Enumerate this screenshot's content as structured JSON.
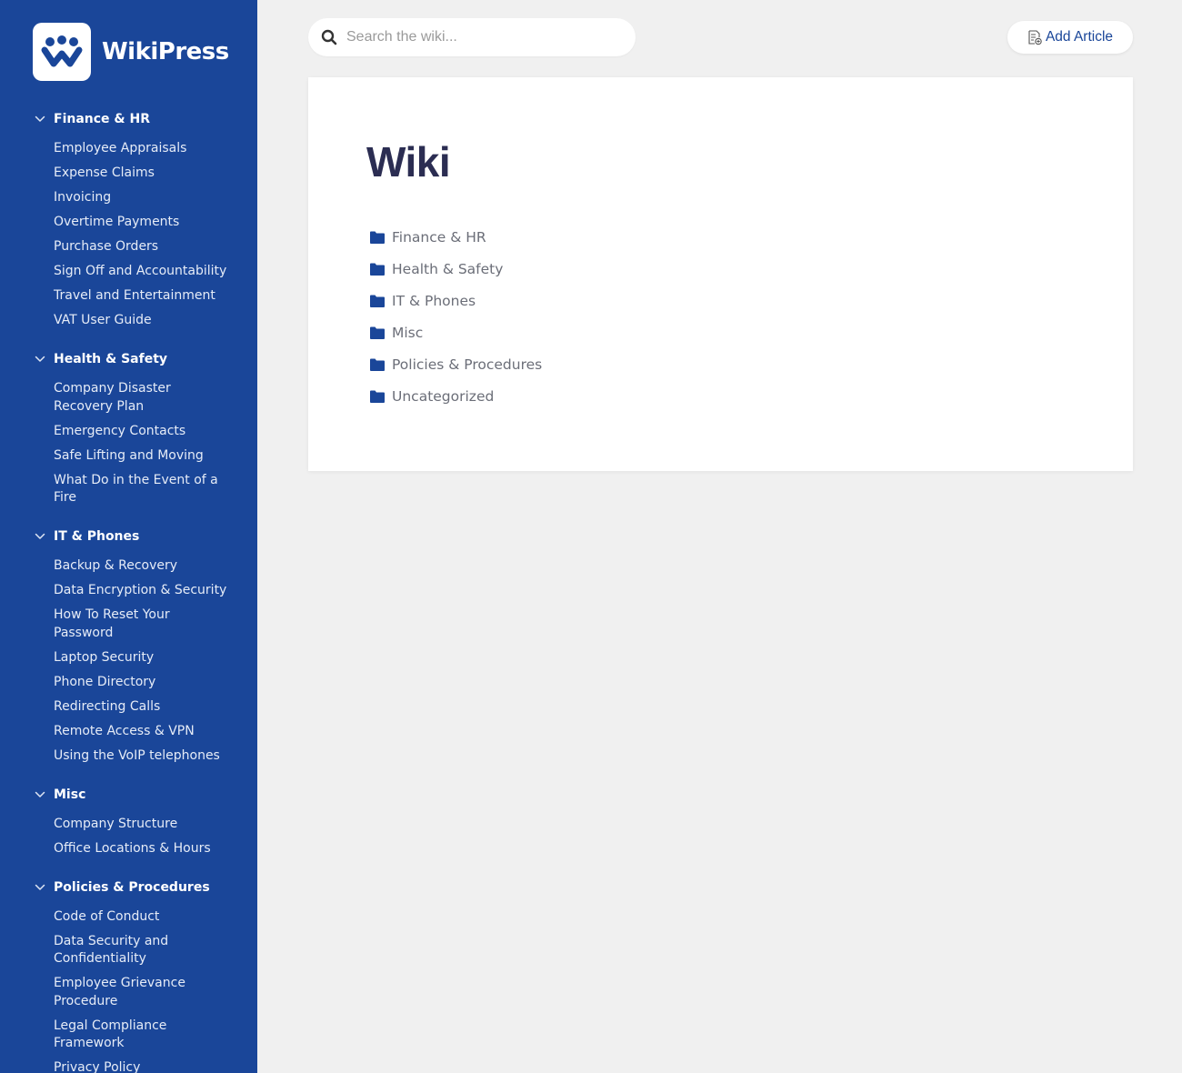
{
  "app": {
    "name": "WikiPress"
  },
  "search": {
    "placeholder": "Search the wiki..."
  },
  "toolbar": {
    "add_article_label": "Add Article"
  },
  "main": {
    "title": "Wiki",
    "categories": [
      "Finance & HR",
      "Health & Safety",
      "IT & Phones",
      "Misc",
      "Policies & Procedures",
      "Uncategorized"
    ]
  },
  "sidebar": {
    "groups": [
      {
        "title": "Finance & HR",
        "items": [
          "Employee Appraisals",
          "Expense Claims",
          "Invoicing",
          "Overtime Payments",
          "Purchase Orders",
          "Sign Off and Accountability",
          "Travel and Entertainment",
          "VAT User Guide"
        ]
      },
      {
        "title": "Health & Safety",
        "items": [
          "Company Disaster Recovery Plan",
          "Emergency Contacts",
          "Safe Lifting and Moving",
          "What Do in the Event of a Fire"
        ]
      },
      {
        "title": "IT & Phones",
        "items": [
          "Backup & Recovery",
          "Data Encryption & Security",
          "How To Reset Your Password",
          "Laptop Security",
          "Phone Directory",
          "Redirecting Calls",
          "Remote Access & VPN",
          "Using the VoIP telephones"
        ]
      },
      {
        "title": "Misc",
        "items": [
          "Company Structure",
          "Office Locations & Hours"
        ]
      },
      {
        "title": "Policies & Procedures",
        "items": [
          "Code of Conduct",
          "Data Security and Confidentiality",
          "Employee Grievance Procedure",
          "Legal Compliance Framework",
          "Privacy Policy"
        ]
      }
    ]
  },
  "colors": {
    "sidebar_bg": "#1a4699",
    "accent": "#1a4699",
    "page_bg": "#f0f0f0",
    "title": "#2b2d52"
  },
  "icons": {
    "logo": "wikipress-logo-icon",
    "search": "search-icon",
    "add_article": "add-document-icon",
    "folder": "folder-icon",
    "chevron": "chevron-down-icon"
  }
}
